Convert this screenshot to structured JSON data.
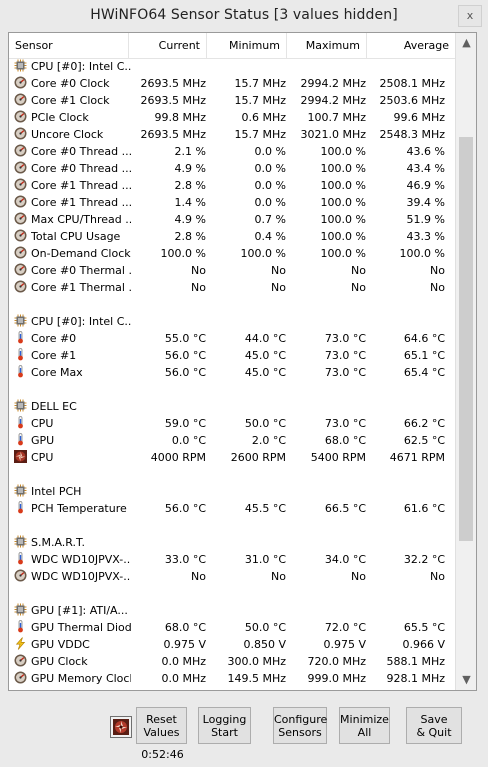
{
  "window": {
    "title": "HWiNFO64 Sensor Status [3 values hidden]",
    "close_label": "x"
  },
  "columns": [
    "Sensor",
    "Current",
    "Minimum",
    "Maximum",
    "Average"
  ],
  "rows": [
    {
      "icon": "cpu-chip-icon",
      "group": true,
      "label": "CPU [#0]: Intel C..."
    },
    {
      "icon": "gauge-icon",
      "label": "Core #0 Clock",
      "cur": "2693.5 MHz",
      "min": "15.7 MHz",
      "max": "2994.2 MHz",
      "avg": "2508.1 MHz"
    },
    {
      "icon": "gauge-icon",
      "label": "Core #1 Clock",
      "cur": "2693.5 MHz",
      "min": "15.7 MHz",
      "max": "2994.2 MHz",
      "avg": "2503.6 MHz"
    },
    {
      "icon": "gauge-icon",
      "label": "PCIe Clock",
      "cur": "99.8 MHz",
      "min": "0.6 MHz",
      "max": "100.7 MHz",
      "avg": "99.6 MHz"
    },
    {
      "icon": "gauge-icon",
      "label": "Uncore Clock",
      "cur": "2693.5 MHz",
      "min": "15.7 MHz",
      "max": "3021.0 MHz",
      "avg": "2548.3 MHz"
    },
    {
      "icon": "gauge-icon",
      "label": "Core #0 Thread ...",
      "cur": "2.1 %",
      "min": "0.0 %",
      "max": "100.0 %",
      "avg": "43.6 %"
    },
    {
      "icon": "gauge-icon",
      "label": "Core #0 Thread ...",
      "cur": "4.9 %",
      "min": "0.0 %",
      "max": "100.0 %",
      "avg": "43.4 %"
    },
    {
      "icon": "gauge-icon",
      "label": "Core #1 Thread ...",
      "cur": "2.8 %",
      "min": "0.0 %",
      "max": "100.0 %",
      "avg": "46.9 %"
    },
    {
      "icon": "gauge-icon",
      "label": "Core #1 Thread ...",
      "cur": "1.4 %",
      "min": "0.0 %",
      "max": "100.0 %",
      "avg": "39.4 %"
    },
    {
      "icon": "gauge-icon",
      "label": "Max CPU/Thread ...",
      "cur": "4.9 %",
      "min": "0.7 %",
      "max": "100.0 %",
      "avg": "51.9 %"
    },
    {
      "icon": "gauge-icon",
      "label": "Total CPU Usage",
      "cur": "2.8 %",
      "min": "0.4 %",
      "max": "100.0 %",
      "avg": "43.3 %"
    },
    {
      "icon": "gauge-icon",
      "label": "On-Demand Clock...",
      "cur": "100.0 %",
      "min": "100.0 %",
      "max": "100.0 %",
      "avg": "100.0 %"
    },
    {
      "icon": "gauge-icon",
      "label": "Core #0 Thermal ...",
      "cur": "No",
      "min": "No",
      "max": "No",
      "avg": "No"
    },
    {
      "icon": "gauge-icon",
      "label": "Core #1 Thermal ...",
      "cur": "No",
      "min": "No",
      "max": "No",
      "avg": "No"
    },
    {
      "blank": true
    },
    {
      "icon": "cpu-chip-icon",
      "group": true,
      "label": "CPU [#0]: Intel C..."
    },
    {
      "icon": "thermometer-icon",
      "label": "Core #0",
      "cur": "55.0 °C",
      "min": "44.0 °C",
      "max": "73.0 °C",
      "avg": "64.6 °C"
    },
    {
      "icon": "thermometer-icon",
      "label": "Core #1",
      "cur": "56.0 °C",
      "min": "45.0 °C",
      "max": "73.0 °C",
      "avg": "65.1 °C"
    },
    {
      "icon": "thermometer-icon",
      "label": "Core Max",
      "cur": "56.0 °C",
      "min": "45.0 °C",
      "max": "73.0 °C",
      "avg": "65.4 °C"
    },
    {
      "blank": true
    },
    {
      "icon": "cpu-chip-icon",
      "group": true,
      "label": "DELL EC"
    },
    {
      "icon": "thermometer-icon",
      "label": "CPU",
      "cur": "59.0 °C",
      "min": "50.0 °C",
      "max": "73.0 °C",
      "avg": "66.2 °C"
    },
    {
      "icon": "thermometer-icon",
      "label": "GPU",
      "cur": "0.0 °C",
      "min": "2.0 °C",
      "max": "68.0 °C",
      "avg": "62.5 °C"
    },
    {
      "icon": "fan-icon",
      "label": "CPU",
      "cur": "4000 RPM",
      "min": "2600 RPM",
      "max": "5400 RPM",
      "avg": "4671 RPM"
    },
    {
      "blank": true
    },
    {
      "icon": "cpu-chip-icon",
      "group": true,
      "label": "Intel PCH"
    },
    {
      "icon": "thermometer-icon",
      "label": "PCH Temperature",
      "cur": "56.0 °C",
      "min": "45.5 °C",
      "max": "66.5 °C",
      "avg": "61.6 °C"
    },
    {
      "blank": true
    },
    {
      "icon": "cpu-chip-icon",
      "group": true,
      "label": "S.M.A.R.T."
    },
    {
      "icon": "thermometer-icon",
      "label": "WDC WD10JPVX-...",
      "cur": "33.0 °C",
      "min": "31.0 °C",
      "max": "34.0 °C",
      "avg": "32.2 °C"
    },
    {
      "icon": "gauge-icon",
      "label": "WDC WD10JPVX-...",
      "cur": "No",
      "min": "No",
      "max": "No",
      "avg": "No"
    },
    {
      "blank": true
    },
    {
      "icon": "cpu-chip-icon",
      "group": true,
      "label": "GPU [#1]: ATI/A..."
    },
    {
      "icon": "thermometer-icon",
      "label": "GPU Thermal Diode",
      "cur": "68.0 °C",
      "min": "50.0 °C",
      "max": "72.0 °C",
      "avg": "65.5 °C"
    },
    {
      "icon": "lightning-icon",
      "label": "GPU VDDC",
      "cur": "0.975 V",
      "min": "0.850 V",
      "max": "0.975 V",
      "avg": "0.966 V"
    },
    {
      "icon": "gauge-icon",
      "label": "GPU Clock",
      "cur": "0.0 MHz",
      "min": "300.0 MHz",
      "max": "720.0 MHz",
      "avg": "588.1 MHz"
    },
    {
      "icon": "gauge-icon",
      "label": "GPU Memory Clock",
      "cur": "0.0 MHz",
      "min": "149.5 MHz",
      "max": "999.0 MHz",
      "avg": "928.1 MHz"
    }
  ],
  "scrollbar": {
    "up_icon": "chevron-up-icon",
    "down_icon": "chevron-down-icon"
  },
  "buttons": [
    {
      "name": "reset-values-button",
      "line1": "Reset",
      "line2": "Values"
    },
    {
      "name": "logging-start-button",
      "line1": "Logging",
      "line2": "Start"
    },
    {
      "name": "configure-sensors-button",
      "line1": "Configure",
      "line2": "Sensors"
    },
    {
      "name": "minimize-all-button",
      "line1": "Minimize",
      "line2": "All"
    },
    {
      "name": "save-quit-button",
      "line1": "Save",
      "line2": "& Quit"
    }
  ],
  "timer": "0:52:46",
  "colors": {
    "window_bg": "#eaeaea",
    "panel_bg": "#ffffff",
    "button_bg": "#e1e1e1"
  }
}
